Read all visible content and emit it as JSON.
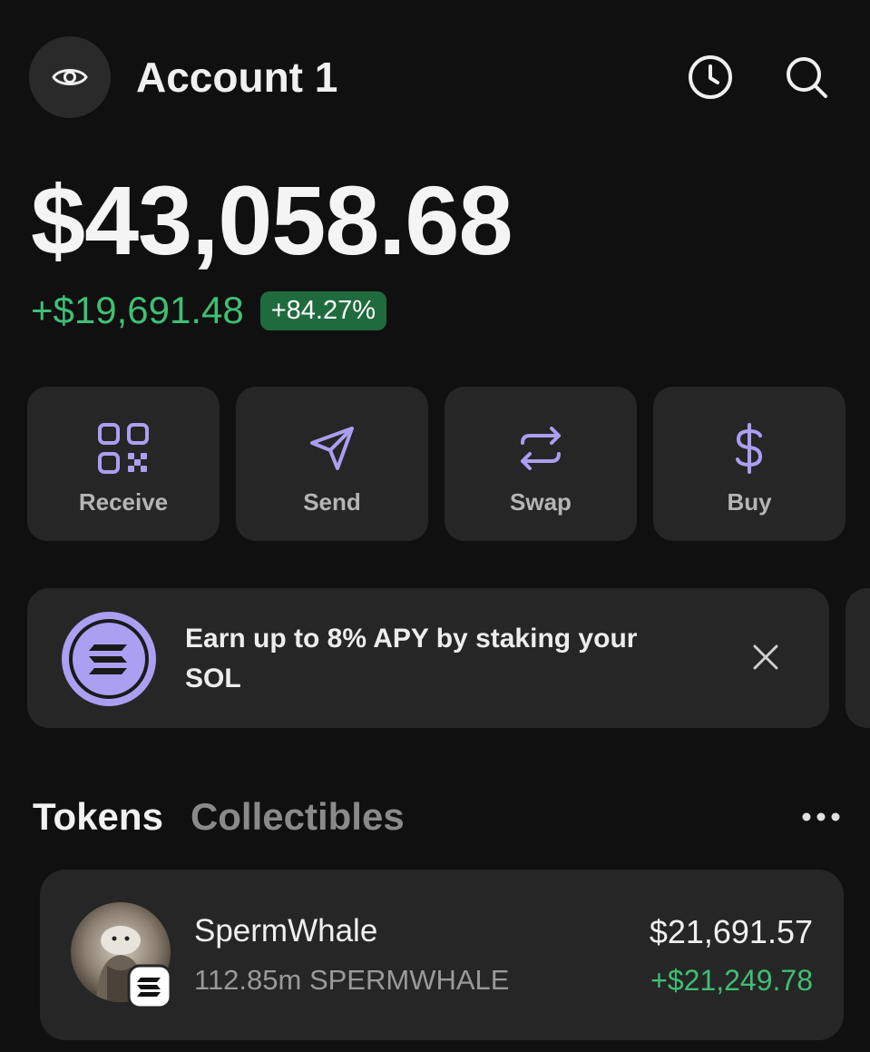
{
  "header": {
    "account_name": "Account 1",
    "icons": [
      "eye-icon",
      "history-icon",
      "search-icon"
    ]
  },
  "balance": {
    "total": "$43,058.68",
    "change_value": "+$19,691.48",
    "change_percent": "+84.27%"
  },
  "actions": [
    {
      "label": "Receive",
      "icon": "qr-code-icon"
    },
    {
      "label": "Send",
      "icon": "send-icon"
    },
    {
      "label": "Swap",
      "icon": "swap-icon"
    },
    {
      "label": "Buy",
      "icon": "dollar-icon"
    }
  ],
  "promo": {
    "text": "Earn up to 8% APY by staking your SOL",
    "icon": "solana-logo-icon"
  },
  "tabs": [
    {
      "label": "Tokens",
      "active": true
    },
    {
      "label": "Collectibles",
      "active": false
    }
  ],
  "tokens": [
    {
      "name": "SpermWhale",
      "amount": "112.85m SPERMWHALE",
      "value": "$21,691.57",
      "change": "+$21,249.78"
    }
  ],
  "colors": {
    "background": "#101010",
    "card": "#262626",
    "accent_purple": "#ab9ff2",
    "positive_green": "#3fbf74",
    "badge_green": "#1f6b3e"
  }
}
